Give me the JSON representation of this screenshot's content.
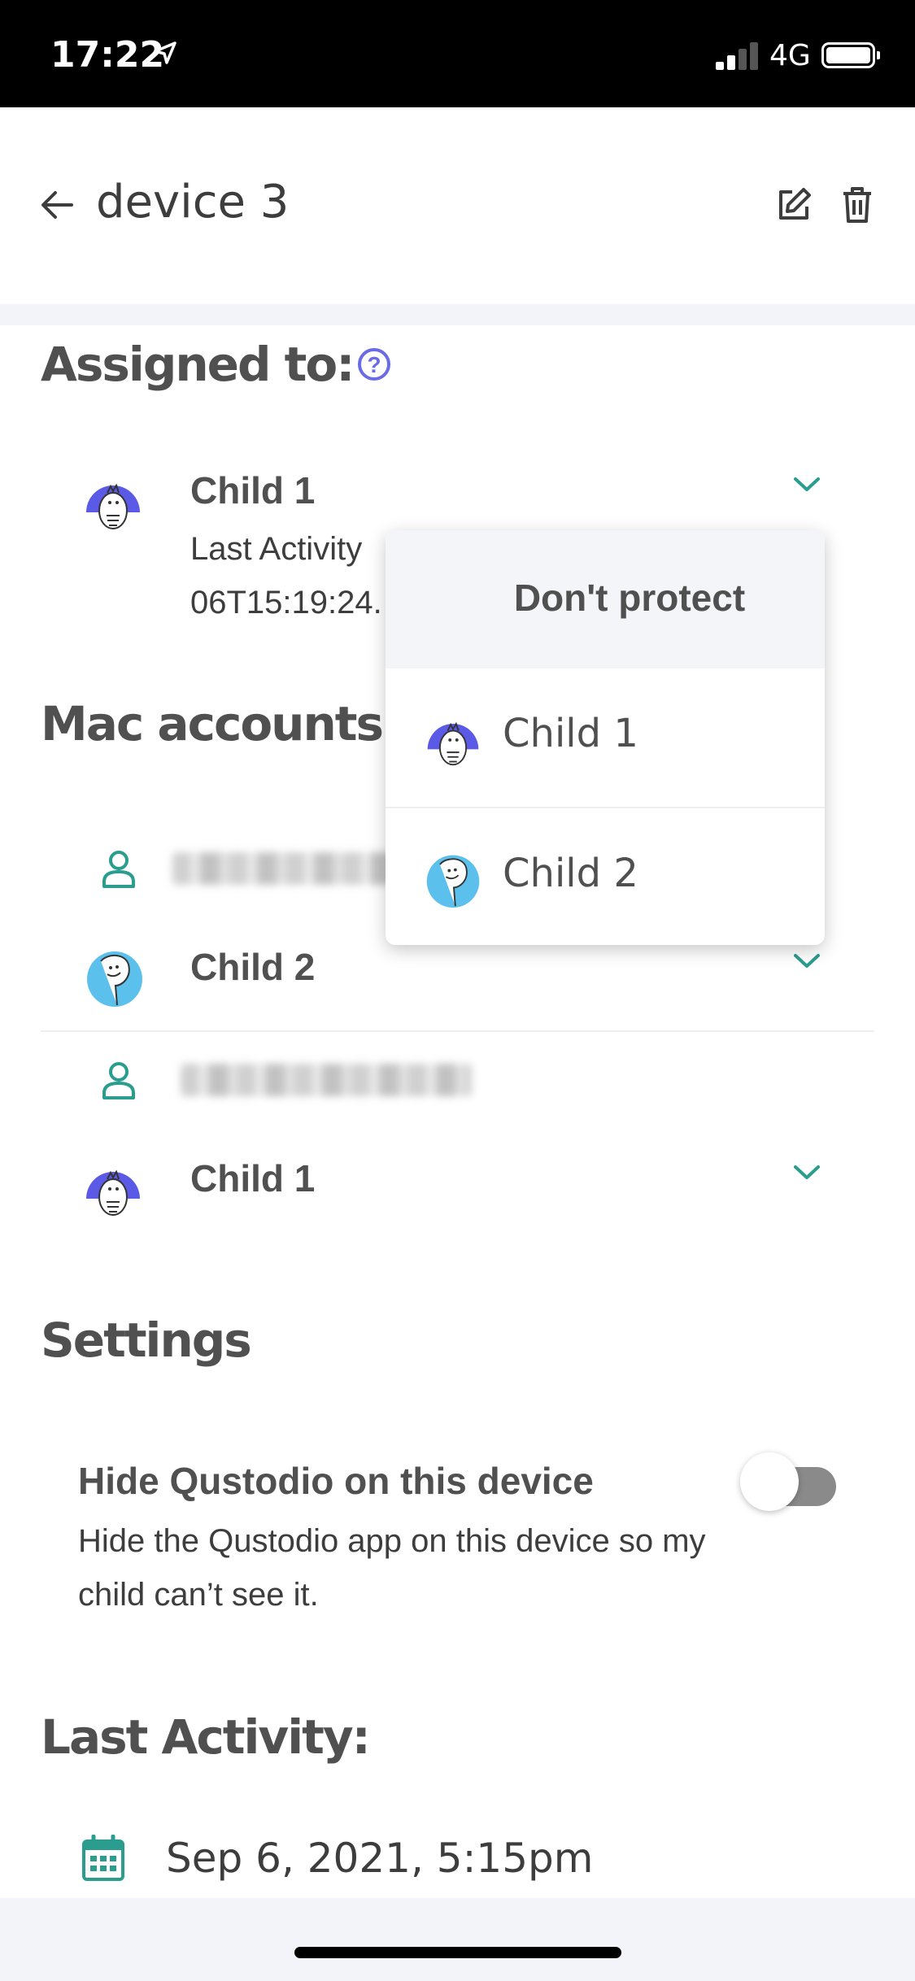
{
  "status_bar": {
    "time": "17:22",
    "network": "4G"
  },
  "header": {
    "title": "device 3"
  },
  "assigned": {
    "heading": "Assigned to:",
    "help_glyph": "?"
  },
  "assigned_child": {
    "name": "Child 1",
    "last_activity_line1": "Last Activity",
    "last_activity_line2": "06T15:19:24."
  },
  "accounts": {
    "heading": "Mac accounts /",
    "rows": [
      {
        "child": "Child 2"
      },
      {
        "child": "Child 1"
      }
    ]
  },
  "dropdown": {
    "header": "Don't protect",
    "options": [
      {
        "label": "Child 1"
      },
      {
        "label": "Child 2"
      }
    ]
  },
  "settings": {
    "heading": "Settings",
    "hide_title": "Hide Qustodio on this device",
    "hide_desc": "Hide the Qustodio app on this device so my child can’t see it.",
    "hide_enabled": false
  },
  "last_activity": {
    "heading": "Last Activity:",
    "date": "Sep 6, 2021, 5:15pm"
  },
  "colors": {
    "accent_teal": "#2a9d8f",
    "help_purple": "#6b6be6",
    "avatar_blue": "#5a5ae6",
    "avatar_cyan": "#5bc0eb"
  }
}
